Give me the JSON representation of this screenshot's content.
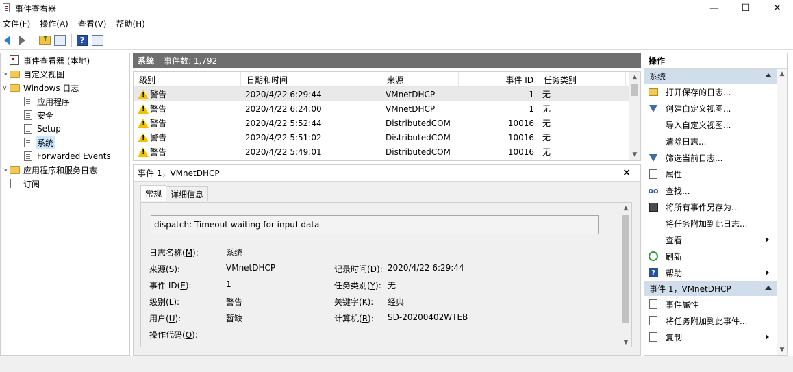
{
  "window": {
    "title": "事件查看器",
    "minimize": "—",
    "maximize": "☐",
    "close": "✕"
  },
  "menu": [
    "文件(F)",
    "操作(A)",
    "查看(V)",
    "帮助(H)"
  ],
  "tree": {
    "root": "事件查看器 (本地)",
    "custom_views": "自定义视图",
    "windows_logs": "Windows 日志",
    "application": "应用程序",
    "security": "安全",
    "setup": "Setup",
    "system": "系统",
    "forwarded": "Forwarded Events",
    "app_services": "应用程序和服务日志",
    "subscriptions": "订阅"
  },
  "center": {
    "log_name": "系统",
    "event_count": "事件数: 1,792"
  },
  "events": {
    "columns": [
      "级别",
      "日期和时间",
      "来源",
      "事件 ID",
      "任务类别"
    ],
    "rows": [
      {
        "level": "警告",
        "datetime": "2020/4/22 6:29:44",
        "source": "VMnetDHCP",
        "id": "1",
        "task": "无"
      },
      {
        "level": "警告",
        "datetime": "2020/4/22 6:24:00",
        "source": "VMnetDHCP",
        "id": "1",
        "task": "无"
      },
      {
        "level": "警告",
        "datetime": "2020/4/22 5:52:44",
        "source": "DistributedCOM",
        "id": "10016",
        "task": "无"
      },
      {
        "level": "警告",
        "datetime": "2020/4/22 5:51:02",
        "source": "DistributedCOM",
        "id": "10016",
        "task": "无"
      },
      {
        "level": "警告",
        "datetime": "2020/4/22 5:49:01",
        "source": "DistributedCOM",
        "id": "10016",
        "task": "无"
      }
    ]
  },
  "detail": {
    "title": "事件 1，VMnetDHCP",
    "close": "×",
    "tabs": [
      "常规",
      "详细信息"
    ],
    "message": "dispatch: Timeout waiting for input data",
    "fields": {
      "log_name_label": "日志名称(",
      "log_name_key": "M",
      "log_name_value": "系统",
      "source_label": "来源(",
      "source_key": "S",
      "source_value": "VMnetDHCP",
      "logged_label": "记录时间(",
      "logged_key": "D",
      "logged_value": "2020/4/22 6:29:44",
      "event_id_label": "事件 ID(",
      "event_id_key": "E",
      "event_id_value": "1",
      "task_label": "任务类别(",
      "task_key": "Y",
      "task_value": "无",
      "level_label": "级别(",
      "level_key": "L",
      "level_value": "警告",
      "keywords_label": "关键字(",
      "keywords_key": "K",
      "keywords_value": "经典",
      "user_label": "用户(",
      "user_key": "U",
      "user_value": "暂缺",
      "computer_label": "计算机(",
      "computer_key": "R",
      "computer_value": "SD-20200402WTEB",
      "opcode_label": "操作代码(",
      "opcode_key": "O"
    }
  },
  "actions": {
    "title": "操作",
    "group1": "系统",
    "items1": [
      {
        "label": "打开保存的日志...",
        "icon": "open-folder-icon"
      },
      {
        "label": "创建自定义视图...",
        "icon": "filter-icon"
      },
      {
        "label": "导入自定义视图...",
        "icon": ""
      },
      {
        "label": "清除日志...",
        "icon": ""
      },
      {
        "label": "筛选当前日志...",
        "icon": "filter-icon"
      },
      {
        "label": "属性",
        "icon": "properties-icon"
      },
      {
        "label": "查找...",
        "icon": "find-icon"
      },
      {
        "label": "将所有事件另存为...",
        "icon": "save-icon"
      },
      {
        "label": "将任务附加到此日志...",
        "icon": ""
      },
      {
        "label": "查看",
        "icon": ""
      },
      {
        "label": "刷新",
        "icon": "refresh-icon"
      },
      {
        "label": "帮助",
        "icon": "help-icon"
      }
    ],
    "group2": "事件 1，VMnetDHCP",
    "items2": [
      {
        "label": "事件属性",
        "icon": "properties-icon"
      },
      {
        "label": "将任务附加到此事件...",
        "icon": "task-icon"
      },
      {
        "label": "复制",
        "icon": "copy-icon"
      }
    ]
  }
}
